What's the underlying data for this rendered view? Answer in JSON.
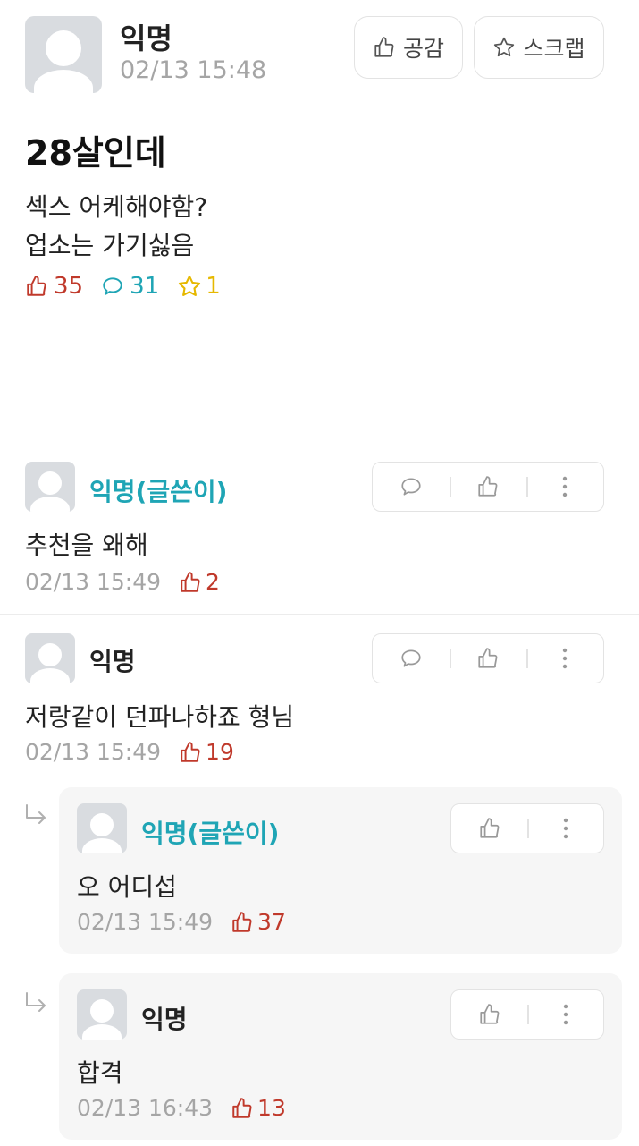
{
  "post": {
    "author": "익명",
    "timestamp": "02/13 15:48",
    "buttons": {
      "like": "공감",
      "scrap": "스크랩"
    },
    "title": "28살인데",
    "body_line1": "섹스 어케해야함?",
    "body_line2": "업소는 가기싫음",
    "stats": {
      "likes": "35",
      "comments": "31",
      "scraps": "1"
    }
  },
  "comments": [
    {
      "author": "익명(글쓴이)",
      "text": "추천을 왜해",
      "timestamp": "02/13 15:49",
      "likes": "2"
    },
    {
      "author": "익명",
      "text": "저랑같이 던파나하죠 형님",
      "timestamp": "02/13 15:49",
      "likes": "19",
      "replies": [
        {
          "author": "익명(글쓴이)",
          "text": "오 어디섭",
          "timestamp": "02/13 15:49",
          "likes": "37"
        },
        {
          "author": "익명",
          "text": "합격",
          "timestamp": "02/13 16:43",
          "likes": "13"
        }
      ]
    }
  ],
  "colors": {
    "author_accent": "#1fa5b5",
    "like": "#c0392b",
    "comment": "#1fa5b5",
    "scrap": "#e6b800",
    "muted": "#a5a5a5"
  },
  "icons": {
    "like": "thumbs-up-icon",
    "comment": "speech-bubble-icon",
    "scrap": "star-icon",
    "more": "vertical-dots-icon",
    "reply": "reply-arrow-icon"
  }
}
